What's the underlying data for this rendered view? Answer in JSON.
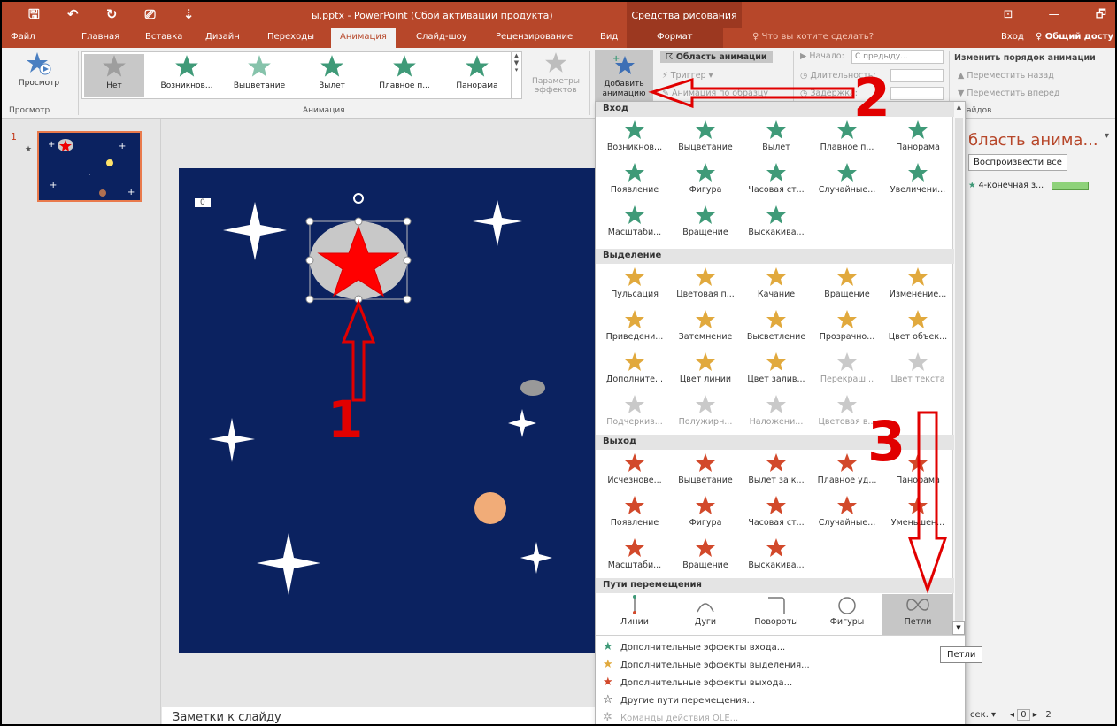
{
  "window": {
    "title": "ы.pptx - PowerPoint (Сбой активации продукта)",
    "context_tab_group": "Средства рисования",
    "controls": [
      "⊡",
      "—",
      "🗗"
    ]
  },
  "qat": {
    "save": "🖫",
    "undo": "↶",
    "redo": "↻",
    "present": "⎚",
    "more": "⇣"
  },
  "tabs": [
    "Файл",
    "Главная",
    "Вставка",
    "Дизайн",
    "Переходы",
    "Анимация",
    "Слайд-шоу",
    "Рецензирование",
    "Вид",
    "Формат"
  ],
  "active_tab": "Анимация",
  "tell_me": "♀ Что вы хотите сделать?",
  "sign_in": "Вход",
  "share": "♀ Общий досту",
  "ribbon": {
    "preview_label": "Просмотр",
    "preview_group": "Просмотр",
    "animation_group": "Анимация",
    "gallery": [
      "Нет",
      "Возникнов...",
      "Выцветание",
      "Вылет",
      "Плавное п...",
      "Панорама"
    ],
    "effect_params": "Параметры эффектов",
    "add_animation": "Добавить анимацию",
    "animation_pane": "Область анимации",
    "trigger": "Триггер",
    "painter": "Анимация по образцу",
    "start_label": "Начало:",
    "start_value": "С предыду...",
    "duration_label": "Длительность:",
    "delay_label": "Задержка:",
    "reorder_title": "Изменить порядок анимации",
    "move_back": "Переместить назад",
    "move_forward": "Переместить вперед",
    "slides_group_partial": "айдов"
  },
  "slide_number": "1",
  "slide_badge": "0",
  "dropdown": {
    "sections": {
      "entrance": "Вход",
      "emphasis": "Выделение",
      "exit": "Выход",
      "paths": "Пути перемещения"
    },
    "entrance": [
      "Возникнов...",
      "Выцветание",
      "Вылет",
      "Плавное п...",
      "Панорама",
      "Появление",
      "Фигура",
      "Часовая ст...",
      "Случайные...",
      "Увеличени...",
      "Масштаби...",
      "Вращение",
      "Выскакива..."
    ],
    "emphasis": [
      "Пульсация",
      "Цветовая п...",
      "Качание",
      "Вращение",
      "Изменение...",
      "Приведени...",
      "Затемнение",
      "Высветление",
      "Прозрачно...",
      "Цвет объек...",
      "Дополните...",
      "Цвет линии",
      "Цвет залив...",
      "Перекраш...",
      "Цвет текста",
      "Подчеркив...",
      "Полужирн...",
      "Наложени...",
      "Цветовая в..."
    ],
    "exit": [
      "Исчезнове...",
      "Выцветание",
      "Вылет за к...",
      "Плавное уд...",
      "Панорама",
      "Появление",
      "Фигура",
      "Часовая ст...",
      "Случайные...",
      "Уменьшен...",
      "Масштаби...",
      "Вращение",
      "Выскакива..."
    ],
    "paths": [
      "Линии",
      "Дуги",
      "Повороты",
      "Фигуры",
      "Петли"
    ],
    "more": [
      "Дополнительные эффекты входа...",
      "Дополнительные эффекты выделения...",
      "Дополнительные эффекты выхода...",
      "Другие пути перемещения...",
      "Команды действия OLE..."
    ]
  },
  "tooltip": "Петли",
  "pane": {
    "title": "бласть анима...",
    "play_all": "Воспроизвести все",
    "item": "4-конечная з..."
  },
  "notes": "Заметки к слайду",
  "status": {
    "sec": "сек.",
    "page": "0",
    "total": "2"
  },
  "annotations": [
    "1",
    "2",
    "3"
  ],
  "colors": {
    "ribbon": "#b7472a",
    "slide_bg": "#0b2260",
    "entrance_star": "#3f9a78",
    "emphasis_star": "#e1a93d",
    "exit_star": "#d2492b",
    "annotation": "#e10000"
  }
}
